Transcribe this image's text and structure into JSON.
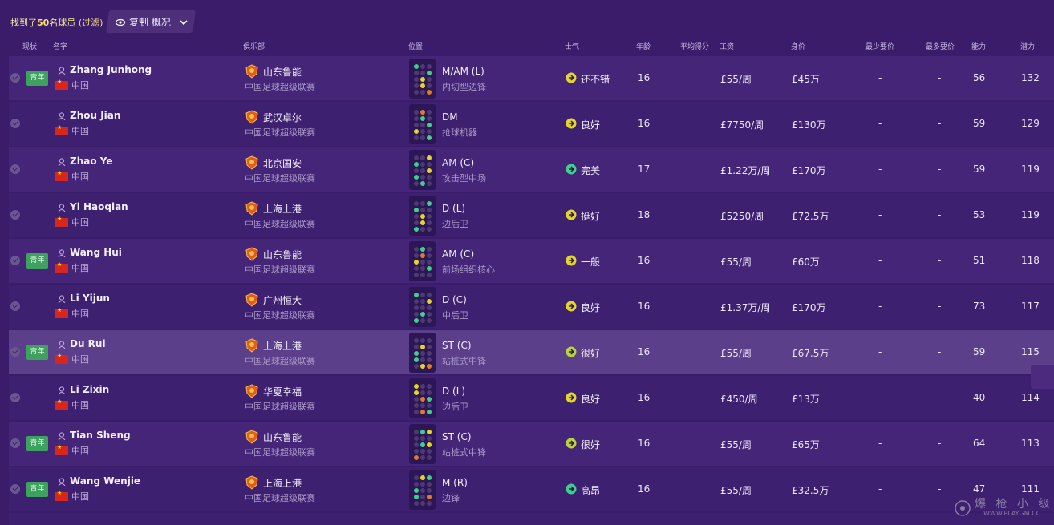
{
  "toolbar": {
    "found_prefix": "找到了",
    "found_count": "50",
    "found_suffix": "名球员 ",
    "filter_label": "(过滤)",
    "copy_label": "复制 概况"
  },
  "columns": {
    "status": "现状",
    "name": "名字",
    "club": "俱乐部",
    "position": "位置",
    "morale": "士气",
    "age": "年龄",
    "avg_rating": "平均得分",
    "wage": "工资",
    "value": "身价",
    "min_fee": "最少要价",
    "max_fee": "最多要价",
    "ability": "能力",
    "potential": "潜力"
  },
  "colors": {
    "background": "#3a1c6a",
    "row": "#452577",
    "row_alt": "#3e2070",
    "row_selected": "#5b3f8a",
    "youth_badge": "#3ea160",
    "morale_good": "#e3d62a",
    "morale_great": "#3ed08e",
    "flag_red": "#d7261e"
  },
  "players": [
    {
      "youth": "青年",
      "name": "Zhang Junhong",
      "nationality": "中国",
      "club": "山东鲁能",
      "club_icon": "shandong-luneng-crest",
      "league": "中国足球超级联赛",
      "position": "M/AM (L)",
      "role": "内切型边锋",
      "morale": "还不错",
      "morale_icon": "arrow-right",
      "age": "16",
      "avg_rating": "",
      "wage": "£55/周",
      "value": "£45万",
      "min_fee": "-",
      "max_fee": "-",
      "ability": "56",
      "potential": "132"
    },
    {
      "youth": "",
      "name": "Zhou Jian",
      "nationality": "中国",
      "club": "武汉卓尔",
      "club_icon": "wuhan-zall-crest",
      "league": "中国足球超级联赛",
      "position": "DM",
      "role": "抢球机器",
      "morale": "良好",
      "morale_icon": "arrow-up-right",
      "age": "16",
      "avg_rating": "",
      "wage": "£7750/周",
      "value": "£130万",
      "min_fee": "-",
      "max_fee": "-",
      "ability": "59",
      "potential": "129"
    },
    {
      "youth": "",
      "name": "Zhao Ye",
      "nationality": "中国",
      "club": "北京国安",
      "club_icon": "beijing-guoan-crest",
      "league": "中国足球超级联赛",
      "position": "AM (C)",
      "role": "攻击型中场",
      "morale": "完美",
      "morale_icon": "arrow-up",
      "age": "17",
      "avg_rating": "",
      "wage": "£1.22万/周",
      "value": "£170万",
      "min_fee": "-",
      "max_fee": "-",
      "ability": "59",
      "potential": "119"
    },
    {
      "youth": "",
      "name": "Yi Haoqian",
      "nationality": "中国",
      "club": "上海上港",
      "club_icon": "shanghai-sipg-crest",
      "league": "中国足球超级联赛",
      "position": "D (L)",
      "role": "边后卫",
      "morale": "挺好",
      "morale_icon": "arrow-up-right",
      "age": "18",
      "avg_rating": "",
      "wage": "£5250/周",
      "value": "£72.5万",
      "min_fee": "-",
      "max_fee": "-",
      "ability": "53",
      "potential": "119"
    },
    {
      "youth": "青年",
      "name": "Wang Hui",
      "nationality": "中国",
      "club": "山东鲁能",
      "club_icon": "shandong-luneng-crest",
      "league": "中国足球超级联赛",
      "position": "AM (C)",
      "role": "前场组织核心",
      "morale": "一般",
      "morale_icon": "arrow-right",
      "age": "16",
      "avg_rating": "",
      "wage": "£55/周",
      "value": "£60万",
      "min_fee": "-",
      "max_fee": "-",
      "ability": "51",
      "potential": "118"
    },
    {
      "youth": "",
      "name": "Li Yijun",
      "nationality": "中国",
      "club": "广州恒大",
      "club_icon": "guangzhou-evergrande-crest",
      "league": "中国足球超级联赛",
      "position": "D (C)",
      "role": "中后卫",
      "morale": "良好",
      "morale_icon": "arrow-up-right",
      "age": "16",
      "avg_rating": "",
      "wage": "£1.37万/周",
      "value": "£170万",
      "min_fee": "-",
      "max_fee": "-",
      "ability": "73",
      "potential": "117"
    },
    {
      "youth": "青年",
      "name": "Du Rui",
      "nationality": "中国",
      "club": "上海上港",
      "club_icon": "shanghai-sipg-crest",
      "league": "中国足球超级联赛",
      "position": "ST (C)",
      "role": "站桩式中锋",
      "morale": "很好",
      "morale_icon": "arrow-up-right",
      "age": "16",
      "avg_rating": "",
      "wage": "£55/周",
      "value": "£67.5万",
      "min_fee": "-",
      "max_fee": "-",
      "ability": "59",
      "potential": "115"
    },
    {
      "youth": "",
      "name": "Li Zixin",
      "nationality": "中国",
      "club": "华夏幸福",
      "club_icon": "hebei-cffc-crest",
      "league": "中国足球超级联赛",
      "position": "D (L)",
      "role": "边后卫",
      "morale": "良好",
      "morale_icon": "arrow-up-right",
      "age": "16",
      "avg_rating": "",
      "wage": "£450/周",
      "value": "£13万",
      "min_fee": "-",
      "max_fee": "-",
      "ability": "40",
      "potential": "114"
    },
    {
      "youth": "青年",
      "name": "Tian Sheng",
      "nationality": "中国",
      "club": "山东鲁能",
      "club_icon": "shandong-luneng-crest",
      "league": "中国足球超级联赛",
      "position": "ST (C)",
      "role": "站桩式中锋",
      "morale": "很好",
      "morale_icon": "arrow-up-right",
      "age": "16",
      "avg_rating": "",
      "wage": "£55/周",
      "value": "£65万",
      "min_fee": "-",
      "max_fee": "-",
      "ability": "64",
      "potential": "113"
    },
    {
      "youth": "青年",
      "name": "Wang Wenjie",
      "nationality": "中国",
      "club": "上海上港",
      "club_icon": "shanghai-sipg-crest",
      "league": "中国足球超级联赛",
      "position": "M (R)",
      "role": "边锋",
      "morale": "高昂",
      "morale_icon": "arrow-up-left",
      "age": "16",
      "avg_rating": "",
      "wage": "£55/周",
      "value": "£32.5万",
      "min_fee": "-",
      "max_fee": "-",
      "ability": "47",
      "potential": "111"
    }
  ],
  "watermark": {
    "text": "爆 枪 小 级",
    "url": "WWW.PLAYGM.CC"
  }
}
